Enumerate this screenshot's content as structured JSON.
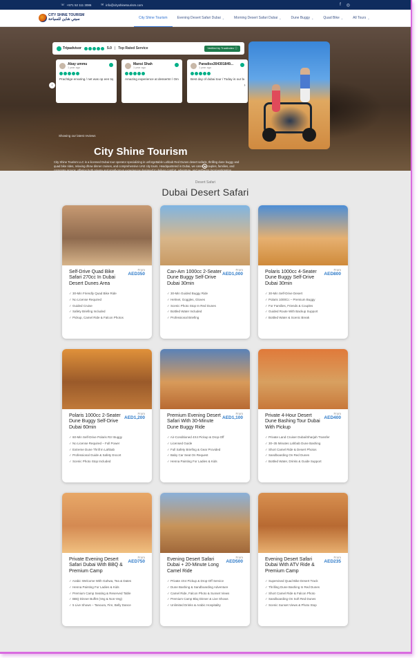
{
  "topbar": {
    "phone": "+971 52 111 3086",
    "email": "info@cityshinetourism.com",
    "social": [
      "f",
      "◎"
    ]
  },
  "brand": {
    "name_en": "CITY SHINE TOURISM",
    "name_ar": "سيتي شاين للسياحة"
  },
  "nav": [
    {
      "label": "City Shine Tourism",
      "dropdown": false,
      "active": true
    },
    {
      "label": "Evening Desert Safari Dubai",
      "dropdown": true
    },
    {
      "label": "Morning Desert Safari Dubai",
      "dropdown": true
    },
    {
      "label": "Dune Buggy",
      "dropdown": true
    },
    {
      "label": "Quad Bike",
      "dropdown": true
    },
    {
      "label": "All Tours",
      "dropdown": true
    }
  ],
  "hero": {
    "tripadvisor": {
      "brand": "Tripadvisor",
      "score": "5.0",
      "label": "Top Rated Service",
      "verified": "Verified by TrustIndex ⓘ"
    },
    "reviews": [
      {
        "name": "Akay ummu",
        "ago": "1 year ago",
        "text": "Prachtige ervaring / net was op een top! Heel vriendelij"
      },
      {
        "name": "Mansi Shah",
        "ago": "1 year ago",
        "text": "Amazing experience at desserts! / Om 21st March 2025 we went for"
      },
      {
        "name": "Paradiss304301849...",
        "ago": "1 year ago",
        "text": "Best day of dubai tour / Today is our best day of dubai to"
      }
    ],
    "showing": "Showing our latest reviews",
    "title": "City Shine Tourism",
    "description": "City Shine Tourism LLC is a licensed Dubai tour operator specializing in unforgettable Lahbab Red Dunes desert safaris, thrilling dune buggy and quad bike rides, relaxing dhow dinner cruises, and comprehensive UAE city tours. Headquartered in Dubai, we cater to couples, families, and corporate groups, offering both private and small-group experiences designed to deliver comfort, adventure, and authentic local exploration."
  },
  "section": {
    "kicker": "Desert Safari",
    "title": "Dubai Desert Safari"
  },
  "tours": [
    {
      "title": "Self-Drive Quad Bike Safari 270cc In Dubai Desert Dunes Area",
      "from": "From",
      "price": "AED350",
      "features": [
        "30-Min Friendly Quad Bike Ride",
        "No License Required",
        "Guided Cruise",
        "Safety Briefing Included",
        "Pickup, Camel Ride & Falcon Photos"
      ],
      "img": [
        "#c79a72",
        "#8e6a4e",
        "#d7b48a"
      ]
    },
    {
      "title": "Can-Am 1000cc 2-Seater Dune Buggy Self-Drive Dubai 30min",
      "from": "From",
      "price": "AED1,000",
      "features": [
        "30-Min Guided Buggy Ride",
        "Helmet, Goggles, Gloves",
        "Scenic Photo Stop In Red Dunes",
        "Bottled Water Included",
        "Professional Briefing"
      ],
      "img": [
        "#7fb5e2",
        "#d8b68a",
        "#c89a64"
      ]
    },
    {
      "title": "Polaris 1000cc 4-Seater Dune Buggy Self-Drive Dubai 30min",
      "from": "From",
      "price": "AED800",
      "features": [
        "30-Min Self-Drive Desert",
        "Polaris 1000Cc – Premium Buggy",
        "For Families, Friends & Couples",
        "Guided Route With Backup Support",
        "Bottled Water & Scenic Break"
      ],
      "img": [
        "#4d8ed6",
        "#e6b070",
        "#cf8a3a"
      ]
    },
    {
      "title": "Polaris 1000cc 2-Seater Dune Buggy Self-Drive Dubai 60min",
      "from": "From",
      "price": "AED1,200",
      "features": [
        "60-Min Self-Drive Polaris Rzr Buggy",
        "No License Required – Full Power",
        "Extreme Dune Thrill In Lahbab",
        "Professional Guide & Safety Escort",
        "Scenic Photo Stop Included"
      ],
      "img": [
        "#e0913a",
        "#9a5a2a",
        "#c07a3a"
      ]
    },
    {
      "title": "Premium Evening Desert Safari With 30-Minute Dune Buggy Ride",
      "from": "From",
      "price": "AED1,100",
      "features": [
        "Air-Conditioned 4X4 Pickup & Drop-Off",
        "Licensed Guide",
        "Full Safety Briefing & Gear Provided",
        "Baby Car Seat On Request",
        "Henna Painting For Ladies & Kids"
      ],
      "img": [
        "#5a82b8",
        "#d89a5a",
        "#b86a32"
      ]
    },
    {
      "title": "Private 4-Hour Desert Dune Bashing Tour Dubai With Pickup",
      "from": "From",
      "price": "AED400",
      "features": [
        "Private Land Cruiser Dubai/Sharjah Transfer",
        "30–35 Minutes Lahbab Dune Bashing",
        "Short Camel Ride & Desert Photos",
        "Sandboarding On Red Dunes",
        "Bottled Water, Drinks & Guide Support"
      ],
      "img": [
        "#e07a3a",
        "#d8a060",
        "#c8783a"
      ]
    },
    {
      "title": "Private Evening Desert Safari Dubai With BBQ & Premium Camp",
      "from": "From",
      "price": "AED750",
      "features": [
        "Arabic Welcome With Gahwa, Tea & Dates",
        "Henna Painting For Ladies & Kids",
        "Premium Camp Seating & Reserved Table",
        "BBQ Dinner Buffet (Veg & Non-Veg)",
        "5 Live Shows – Tanoura, Fire, Belly Dance"
      ],
      "img": [
        "#e8a868",
        "#d48a52",
        "#f0c080"
      ]
    },
    {
      "title": "Evening Desert Safari Dubai + 20-Minute Long Camel Ride",
      "from": "From",
      "price": "AED500",
      "features": [
        "Private 4X4 Pickup & Drop-Off Service",
        "Dune Bashing & Sandboarding Adventure",
        "Camel Ride, Falcon Photo & Sunset Views",
        "Premium Camp Bbq Dinner & Live Shows",
        "Unlimited Drinks & Arabic Hospitality"
      ],
      "img": [
        "#8ab0d8",
        "#c8945a",
        "#a0683a"
      ]
    },
    {
      "title": "Evening Desert Safari Dubai With ATV Ride & Premium Camp",
      "from": "From",
      "price": "AED235",
      "features": [
        "Supervised Quad Bike Desert Track",
        "Thrilling Dune Bashing In Red Dunes",
        "Short Camel Ride & Falcon Photo",
        "Sandboarding On Soft Red Dunes",
        "Scenic Sunset Views & Photo Stop"
      ],
      "img": [
        "#d89050",
        "#b86a32",
        "#e8b070"
      ]
    }
  ]
}
